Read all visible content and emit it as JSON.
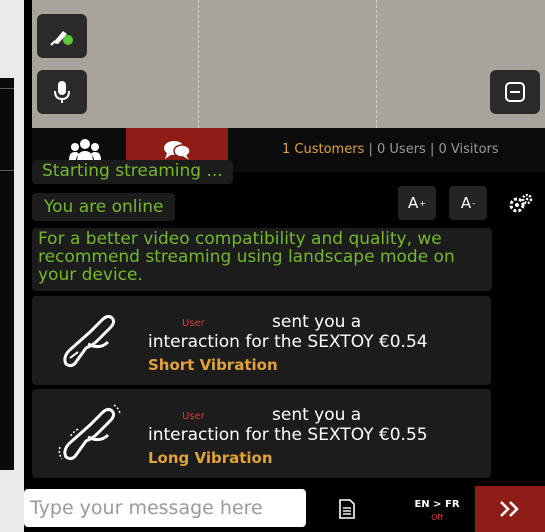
{
  "video": {
    "controls": [
      {
        "name": "toggle-camera-button",
        "icon": "camera-off-icon"
      },
      {
        "name": "microphone-button",
        "icon": "microphone-icon"
      },
      {
        "name": "minimize-button",
        "icon": "minimize-icon"
      }
    ]
  },
  "tabs": [
    {
      "name": "users",
      "icon": "users-icon",
      "active": false
    },
    {
      "name": "chat",
      "icon": "chat-icon",
      "active": true
    }
  ],
  "stats": {
    "customers": "1 Customers",
    "users": "0 Users",
    "visitors": "0 Visitors",
    "separator": "|"
  },
  "chat": {
    "partial_message": "Starting streaming ...",
    "online_message": "You are online",
    "notice": "For a better video compatibility and quality, we recommend streaming using landscape mode on your device.",
    "font_increase": "A",
    "font_increase_sup": "+",
    "font_decrease": "A",
    "font_decrease_sup": "-",
    "interactions": [
      {
        "user": "User",
        "sent": "sent you a",
        "text": "interaction for the SEXTOY €0.54",
        "type": "Short Vibration",
        "icon": "toy-icon"
      },
      {
        "user": "User",
        "sent": "sent you a",
        "text": "interaction for the SEXTOY €0.55",
        "type": "Long Vibration",
        "icon": "toy-vibrating-icon"
      }
    ]
  },
  "bottom": {
    "placeholder": "Type your message here",
    "lang_pair": "EN > FR",
    "lang_status": "Off",
    "send_icon": "double-chevron-right-icon"
  },
  "colors": {
    "accent_red": "#8e1d15",
    "green_text": "#74b92c",
    "orange": "#e2a23a",
    "red_label": "#e23a3a"
  }
}
